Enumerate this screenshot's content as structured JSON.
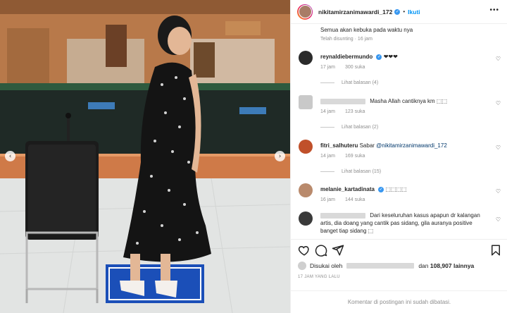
{
  "photo": {
    "prev_arrow": "‹",
    "next_arrow": "›"
  },
  "header": {
    "username": "nikitamirzanimawardi_172",
    "separator": "•",
    "follow_label": "Ikuti",
    "more_glyph": "•••"
  },
  "caption": {
    "text": "Semua akan kebuka pada waktu nya",
    "meta": "Telah disunting · 16 jam"
  },
  "comments": [
    {
      "user": "reynaldiebermundo",
      "verified": true,
      "text": "❤❤❤",
      "time": "17 jam",
      "likes": "300 suka",
      "replies": "Lihat balasan (4)"
    },
    {
      "user": "",
      "verified": false,
      "text": "Masha Allah cantiknya km ⬚⬚",
      "time": "14 jam",
      "likes": "123 suka",
      "replies": "Lihat balasan (2)"
    },
    {
      "user": "fitri_salhuteru",
      "verified": false,
      "text": "Sabar ",
      "mention": "@nikitamirzanimawardi_172",
      "time": "14 jam",
      "likes": "169 suka",
      "replies": "Lihat balasan (15)"
    },
    {
      "user": "melanie_kartadinata",
      "verified": true,
      "text": "⬚⬚⬚⬚",
      "time": "16 jam",
      "likes": "144 suka",
      "replies": ""
    },
    {
      "user": "",
      "verified": false,
      "text": "Dari keseluruhan kasus apapun dr kalangan artis, dia doang yang cantik pas sidang, gila auranya positive banget tiap sidang ⬚",
      "time": "",
      "likes": "",
      "replies": ""
    }
  ],
  "likes_line": {
    "prefix": "Disukai oleh",
    "middle": "dan",
    "count": "108,907",
    "suffix": "lainnya"
  },
  "timestamp": "17 JAM YANG LALU",
  "footer": "Komentar di postingan ini sudah dibatasi.",
  "colors": {
    "accent": "#0095f6",
    "verified": "#3897f0",
    "muted": "#8e8e8e"
  }
}
